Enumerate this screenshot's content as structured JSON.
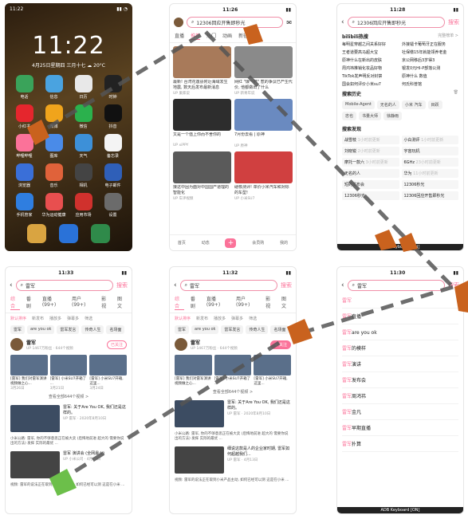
{
  "home": {
    "time": "11:22",
    "status_time": "11:22",
    "date": "4月25日星期四 三月十七 ☁ 20°C",
    "apps": [
      {
        "label": "电话",
        "color": "#3aa35a"
      },
      {
        "label": "信息",
        "color": "#4aa3e0"
      },
      {
        "label": "日历",
        "color": "#e8e8e8"
      },
      {
        "label": "时钟",
        "color": "#222222"
      },
      {
        "label": "小红书",
        "color": "#e5262d"
      },
      {
        "label": "微博",
        "color": "#f0a41c"
      },
      {
        "label": "微信",
        "color": "#2bb14d"
      },
      {
        "label": "抖音",
        "color": "#111111"
      },
      {
        "label": "哔哩哔哩",
        "color": "#fb7299"
      },
      {
        "label": "图库",
        "color": "#4a8be8"
      },
      {
        "label": "天气",
        "color": "#3d90d8"
      },
      {
        "label": "备忘录",
        "color": "#f4f4f4"
      },
      {
        "label": "浏览器",
        "color": "#3a6fd8"
      },
      {
        "label": "音乐",
        "color": "#e0623a"
      },
      {
        "label": "相机",
        "color": "#444444"
      },
      {
        "label": "电子邮件",
        "color": "#2f5fb8"
      },
      {
        "label": "手机管家",
        "color": "#2f7ee0"
      },
      {
        "label": "华为运动健康",
        "color": "#e84f4f"
      },
      {
        "label": "应用市场",
        "color": "#d0312d"
      },
      {
        "label": "设置",
        "color": "#6b6b6b"
      }
    ]
  },
  "feed": {
    "status_time": "11:26",
    "search_text": "12306回应开售即秒光",
    "tabs": [
      "直播",
      "推荐",
      "热门",
      "动画",
      "新征程"
    ],
    "cards": [
      {
        "caption": "最新! 台湾花莲县附近海域发生地震, 数天后发布最新消息",
        "meta": "UP 巢家说",
        "thumb": "#a87a5a"
      },
      {
        "caption": "网红 \"爆一杯\" 惹的争议已产生代价, 他都做出了什么",
        "meta": "UP 新青年说",
        "thumb": "#8a8a8a"
      },
      {
        "caption": "又是一个值上你而不舍你的",
        "meta": "UP xiPPY",
        "thumb": "#2d2d2d"
      },
      {
        "caption": "7月份去看 | 原神",
        "meta": "UP 原神",
        "thumb": "#6a8ac0"
      },
      {
        "caption": "接这中因为面对中国国产道理的智能化",
        "meta": "UP 车评视频",
        "thumb": "#5a5a5a"
      },
      {
        "caption": "硬核测评! 单价小米汽车和对标的车型!",
        "meta": "UP 小米SU7",
        "thumb": "#d04040"
      }
    ],
    "nav": [
      "首页",
      "动态",
      "+",
      "会员购",
      "我的"
    ]
  },
  "search_home": {
    "status_time": "11:28",
    "query": "12306回应开售即秒光",
    "search_label": "搜索",
    "hot_title": "bilibili热搜",
    "hot_more": "完整榜单 >",
    "hot_items": [
      "每明星穿越之间关系好好",
      "外接镭卡葡萄牙正在服务",
      "王者道要高马超大宝",
      "社保缴15年就能领养老金",
      "原神什么在新出的皮肤",
      "京公网移后3岁得3",
      "周鸿祎推销化妆品好物",
      "银发0元HI-P部落公测",
      "TikTok发声明反对封禁",
      "原神什么 数值",
      "国会如何评价小米su7",
      "何氏科普馆"
    ],
    "history_title": "搜索历史",
    "history": [
      "Mobile-Agent",
      "无名的人",
      "小米 汽车",
      "目跃",
      "忠也",
      "书量大师",
      "徐静雨"
    ],
    "discover_title": "搜索发现",
    "discover": [
      {
        "t": "战雪枝",
        "s": "1小时前更新"
      },
      {
        "t": "小白测评",
        "s": "1小时前更新"
      },
      {
        "t": "刘晓锐",
        "s": "2小时前更新"
      },
      {
        "t": "宇宙玩机",
        "s": ""
      },
      {
        "t": "摩托一款六",
        "s": "3小时前更新"
      },
      {
        "t": "6GHz",
        "s": "23小时前更新"
      },
      {
        "t": "无名的人",
        "s": ""
      },
      {
        "t": "华为",
        "s": "11小时前更新"
      },
      {
        "t": "短的发布会",
        "s": ""
      },
      {
        "t": "12306秒光",
        "s": ""
      },
      {
        "t": "12306秒光",
        "s": ""
      },
      {
        "t": "12306回应开售即秒光",
        "s": ""
      }
    ],
    "keyboard": "ADB Keyboard [ON]"
  },
  "results_a": {
    "status_time": "11:33",
    "query": "雷军",
    "search_label": "搜索",
    "tabs": [
      "综合",
      "番剧",
      "直播(99+)",
      "用户(99+)",
      "影视",
      "图文"
    ],
    "subtabs": [
      "默认排序",
      "新发布",
      "播放多",
      "弹幕多",
      "筛选"
    ],
    "chips": [
      "雷军",
      "are you ok",
      "雷军发言",
      "传奇人生",
      "名场面"
    ],
    "user": {
      "name": "雷军",
      "info": "UP 1467万粉丝 · 644个视频",
      "follow": "已关注"
    },
    "videos": [
      {
        "cap": "[雷军] 我们对雷军演讲视频做之心..."
      },
      {
        "cap": "[雷军] 小米SU7开箱了 ..."
      },
      {
        "cap": "[雷军] 小米SU7开箱, 这里..."
      }
    ],
    "dates": [
      "3月26日",
      "3月21日",
      "3月24日"
    ],
    "see_all": "查看全部644个视频 >",
    "results": [
      {
        "title": "雷军: 关于Are You OK, 我们还是这样的。",
        "meta": "UP 雷军 · 2020年8月10日"
      },
      {
        "title": "雷军 演讲会 (全网最火)",
        "meta": "UP 小米公司 · 4月13日"
      }
    ],
    "notes": [
      "小米公路: 雷军, 你的不够意思正在被大卖 (后悔地前进 超大的 需要你说出的方法) 发挥 实际的最优 ...",
      "视频: 雷军的说法正在取到小米产品主动, 如何已经可以测 这是在小米 ..."
    ]
  },
  "results_b": {
    "status_time": "11:32",
    "query": "雷军",
    "follow": "+ 关注",
    "result_title": "雷军: 关于Are You OK, 我们还是这样的。",
    "result2_title": "细说这款是人的企业家时期, 雷军如何超越我们...",
    "result2_meta": "UP 雷军 · 4月13日"
  },
  "suggest": {
    "status_time": "11:30",
    "query": "雷军",
    "search_label": "搜索",
    "items": [
      "雷军",
      "雷军直播",
      "雷军are you ok",
      "雷军的模样",
      "雷军演讲",
      "雷军发布会",
      "雷军周鸿祎",
      "雷军金凡",
      "雷军早期直播",
      "雷军扑算"
    ],
    "keyboard": "ADB Keyboard [ON]"
  }
}
